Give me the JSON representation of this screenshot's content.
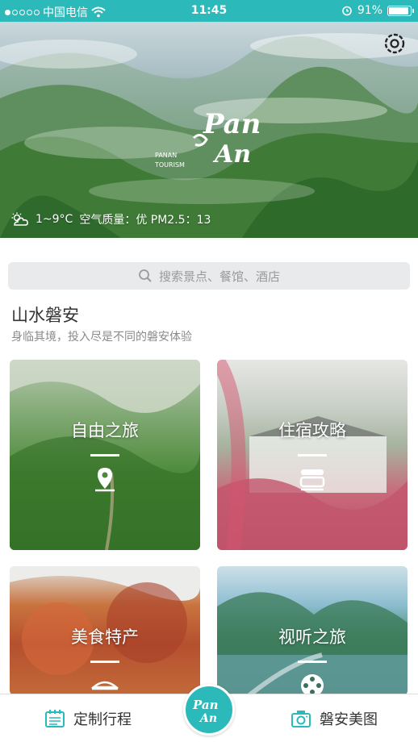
{
  "status_bar": {
    "carrier": "中国电信",
    "time": "11:45",
    "battery": "91%",
    "battery_level": 0.91
  },
  "hero": {
    "logo_text": "PAN AN",
    "logo_sub": "PANAN TOURISM",
    "weather": {
      "icon": "partly-cloudy-icon",
      "temperature": "1~9°C",
      "air_quality": "空气质量：优 PM2.5：13"
    }
  },
  "search": {
    "placeholder": "搜索景点、餐馆、酒店"
  },
  "section": {
    "title": "山水磐安",
    "subtitle": "身临其境，投入尽是不同的磐安体验"
  },
  "cards": [
    {
      "title": "自由之旅",
      "icon": "location-pin-icon"
    },
    {
      "title": "住宿攻略",
      "icon": "bed-icon"
    },
    {
      "title": "美食特产",
      "icon": "food-icon"
    },
    {
      "title": "视听之旅",
      "icon": "film-reel-icon"
    }
  ],
  "bottom_nav": {
    "left_label": "定制行程",
    "right_label": "磐安美图",
    "center_logo": "PAN AN"
  },
  "colors": {
    "accent": "#2cb9b9"
  }
}
